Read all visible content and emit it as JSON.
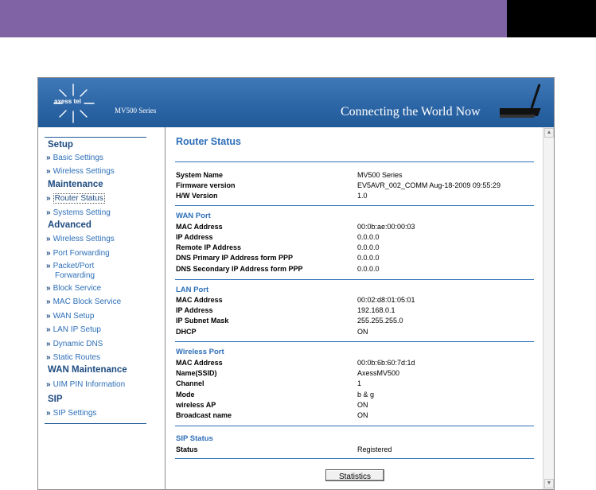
{
  "header": {
    "logo": "axess tel",
    "series": "MV500 Series",
    "tagline": "Connecting the World Now"
  },
  "sidebar": {
    "setup": "Setup",
    "basic_settings": "Basic Settings",
    "wireless_settings": "Wireless Settings",
    "maintenance": "Maintenance",
    "router_status": "Router Status",
    "systems_setting": "Systems Setting",
    "advanced": "Advanced",
    "adv_wireless_settings": "Wireless Settings",
    "port_forwarding": "Port Forwarding",
    "packet_port_forwarding_1": "Packet/Port",
    "packet_port_forwarding_2": "Forwarding",
    "block_service": "Block Service",
    "mac_block_service": "MAC Block Service",
    "wan_setup": "WAN Setup",
    "lan_ip_setup": "LAN IP Setup",
    "dynamic_dns": "Dynamic DNS",
    "static_routes": "Static Routes",
    "wan_maintenance": "WAN Maintenance",
    "uim_pin_information": "UIM PIN Information",
    "sip": "SIP",
    "sip_settings": "SIP Settings",
    "arrow": "»"
  },
  "main": {
    "title": "Router Status",
    "system": {
      "system_name_label": "System Name",
      "system_name": "MV500 Series",
      "firmware_label": "Firmware version",
      "firmware": "EV5AVR_002_COMM Aug-18-2009 09:55:29",
      "hw_label": "H/W Version",
      "hw": "1.0"
    },
    "wan": {
      "heading": "WAN Port",
      "mac_label": "MAC Address",
      "mac": "00:0b:ae:00:00:03",
      "ip_label": "IP Address",
      "ip": "0.0.0.0",
      "remote_label": "Remote IP Address",
      "remote": "0.0.0.0",
      "dns1_label": "DNS Primary IP Address form PPP",
      "dns1": "0.0.0.0",
      "dns2_label": "DNS Secondary IP Address form PPP",
      "dns2": "0.0.0.0"
    },
    "lan": {
      "heading": "LAN Port",
      "mac_label": "MAC Address",
      "mac": "00:02:d8:01:05:01",
      "ip_label": "IP Address",
      "ip": "192.168.0.1",
      "mask_label": "IP Subnet Mask",
      "mask": "255.255.255.0",
      "dhcp_label": "DHCP",
      "dhcp": "ON"
    },
    "wireless": {
      "heading": "Wireless Port",
      "mac_label": "MAC Address",
      "mac": "00:0b:6b:60:7d:1d",
      "ssid_label": "Name(SSID)",
      "ssid": "AxessMV500",
      "channel_label": "Channel",
      "channel": "1",
      "mode_label": "Mode",
      "mode": "b & g",
      "ap_label": "wireless AP",
      "ap": "ON",
      "bcast_label": "Broadcast name",
      "bcast": "ON"
    },
    "sip": {
      "heading": "SIP Status",
      "status_label": "Status",
      "status": "Registered"
    },
    "statistics_button": "Statistics"
  },
  "scrollbar": {
    "up": "▲",
    "down": "▼"
  }
}
